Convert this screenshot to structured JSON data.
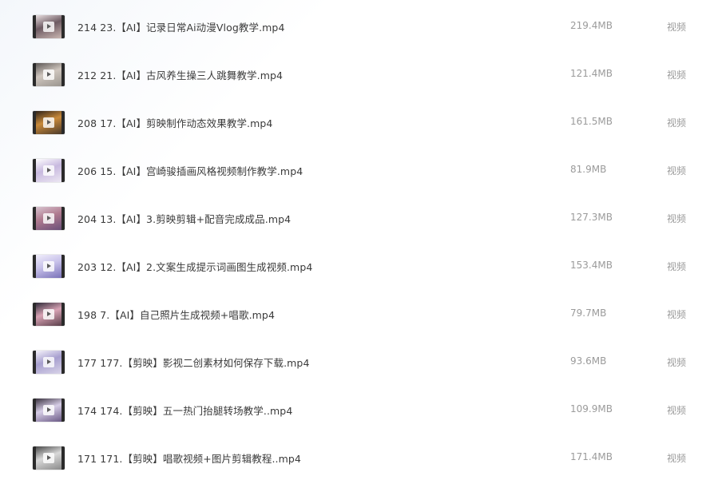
{
  "files": [
    {
      "name": "214 23.【AI】记录日常Ai动漫Vlog教学.mp4",
      "size": "219.4MB",
      "type": "视频",
      "thumb_colors": [
        "#c9b6b1",
        "#6d5a62",
        "#e9dfe1"
      ]
    },
    {
      "name": "212 21.【AI】古风养生操三人跳舞教学.mp4",
      "size": "121.4MB",
      "type": "视频",
      "thumb_colors": [
        "#9a958f",
        "#cfc6be",
        "#5c5755"
      ]
    },
    {
      "name": "208 17.【AI】剪映制作动态效果教学.mp4",
      "size": "161.5MB",
      "type": "视频",
      "thumb_colors": [
        "#4a3a2a",
        "#c98a3a",
        "#2e2218"
      ]
    },
    {
      "name": "206 15.【AI】宫崎骏插画风格视频制作教学.mp4",
      "size": "81.9MB",
      "type": "视频",
      "thumb_colors": [
        "#ece7f2",
        "#c8b9df",
        "#ffffff"
      ]
    },
    {
      "name": "204 13.【AI】3.剪映剪辑+配音完成成品.mp4",
      "size": "127.3MB",
      "type": "视频",
      "thumb_colors": [
        "#6a4f78",
        "#b07a8f",
        "#d8c4d0"
      ]
    },
    {
      "name": "203 12.【AI】2.文案生成提示词画图生成视频.mp4",
      "size": "153.4MB",
      "type": "视频",
      "thumb_colors": [
        "#7a72b8",
        "#c8c2ea",
        "#f1eefb"
      ]
    },
    {
      "name": "198 7.【AI】自己照片生成视频+唱歌.mp4",
      "size": "79.7MB",
      "type": "视频",
      "thumb_colors": [
        "#5a3f4a",
        "#d8a2b4",
        "#2e2a38"
      ]
    },
    {
      "name": "177 177.【剪映】影视二创素材如何保存下载.mp4",
      "size": "93.6MB",
      "type": "视频",
      "thumb_colors": [
        "#d9d4e8",
        "#a79fcf",
        "#f5f3fb"
      ]
    },
    {
      "name": "174 174.【剪映】五一热门抬腿转场教学..mp4",
      "size": "109.9MB",
      "type": "视频",
      "thumb_colors": [
        "#6b5a86",
        "#d6cde6",
        "#3b3340"
      ]
    },
    {
      "name": "171 171.【剪映】唱歌视频+图片剪辑教程..mp4",
      "size": "171.4MB",
      "type": "视频",
      "thumb_colors": [
        "#8a8a8a",
        "#d9d9d9",
        "#4a4a4a"
      ]
    }
  ]
}
